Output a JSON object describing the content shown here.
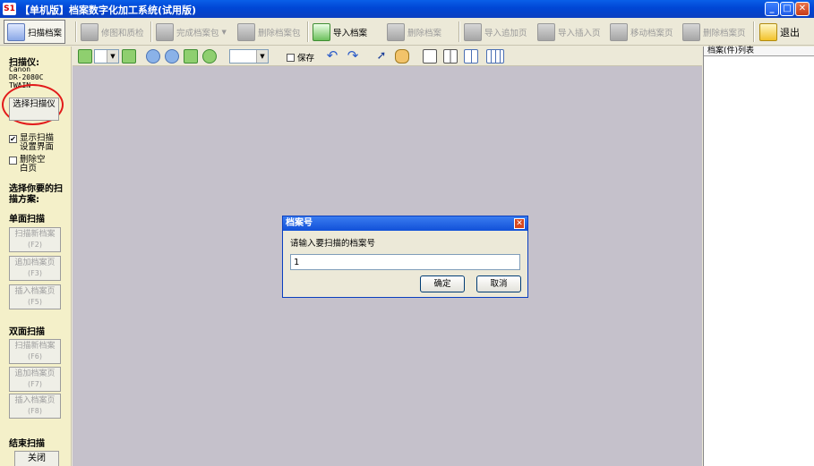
{
  "window": {
    "app_icon": "S1",
    "title": "【单机版】档案数字化加工系统(试用版)",
    "controls": {
      "minimize": "_",
      "maximize": "□",
      "close": "✕"
    }
  },
  "toolbar": {
    "scan_archive": "扫描档案",
    "edit_quality": "修图和质检",
    "finish_package": "完成档案包",
    "delete_package": "删除档案包",
    "import_archive": "导入档案",
    "delete_archive": "删除档案",
    "import_append": "导入追加页",
    "import_insert": "导入插入页",
    "move_page": "移动档案页",
    "delete_page": "删除档案页",
    "exit": "退出"
  },
  "left_panel": {
    "scanner_label": "扫描仪:",
    "scanner_model": "Canon\nDR-2080C\nTWAIN",
    "select_scanner": "选择扫描仪",
    "show_settings": "显示扫描设置界面",
    "show_settings_checked": "✔",
    "delete_blank": "删除空白页",
    "choose_scheme": "选择你要的扫描方案:",
    "single_scan": "单面扫描",
    "double_scan": "双面扫描",
    "end_scan": "结束扫描",
    "close_button": "关闭",
    "single_buttons": [
      {
        "label": "扫描新档案",
        "key": "(F2)"
      },
      {
        "label": "追加档案页",
        "key": "(F3)"
      },
      {
        "label": "插入档案页",
        "key": "(F5)"
      }
    ],
    "double_buttons": [
      {
        "label": "扫描新档案",
        "key": "(F6)"
      },
      {
        "label": "追加档案页",
        "key": "(F7)"
      },
      {
        "label": "插入档案页",
        "key": "(F8)"
      }
    ]
  },
  "viewbar": {
    "save_label": "保存"
  },
  "right_panel": {
    "header": "档案(件)列表"
  },
  "dialog": {
    "title": "档案号",
    "close": "✕",
    "prompt": "请输入要扫描的档案号",
    "input_value": "1",
    "ok": "确定",
    "cancel": "取消"
  },
  "colors": {
    "titlebar": "#0046d5",
    "left_panel_bg": "#f4f0c9",
    "canvas_bg": "#c5c1cb",
    "highlight_circle": "#e21b1b"
  }
}
